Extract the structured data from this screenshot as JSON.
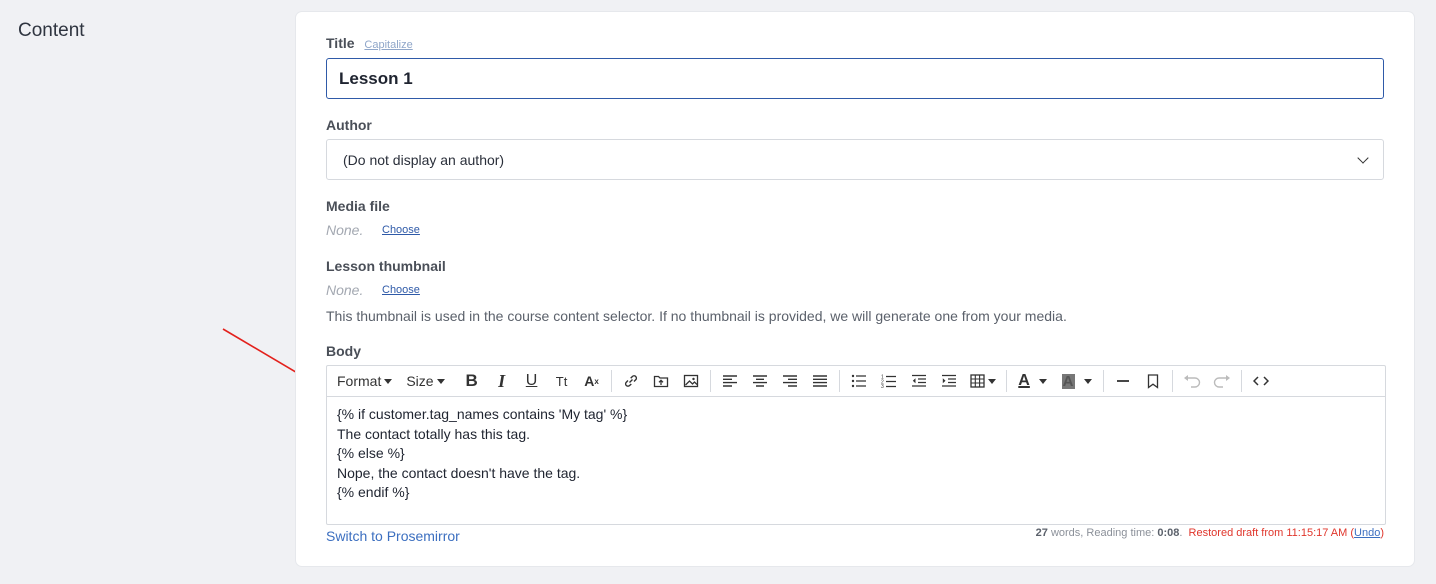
{
  "section": {
    "title": "Content"
  },
  "title_field": {
    "label": "Title",
    "capitalize_link": "Capitalize",
    "value": "Lesson 1"
  },
  "author_field": {
    "label": "Author",
    "selected": "(Do not display an author)"
  },
  "media_field": {
    "label": "Media file",
    "value": "None.",
    "choose_label": "Choose"
  },
  "thumbnail_field": {
    "label": "Lesson thumbnail",
    "value": "None.",
    "choose_label": "Choose",
    "help": "This thumbnail is used in the course content selector. If no thumbnail is provided, we will generate one from your media."
  },
  "body_field": {
    "label": "Body",
    "toolbar": {
      "format_label": "Format",
      "size_label": "Size",
      "tt_label": "Tt"
    },
    "lines": [
      "{% if customer.tag_names contains 'My tag' %}",
      "The contact totally has this tag.",
      "{% else %}",
      "Nope, the contact doesn't have the tag.",
      "{% endif %}"
    ],
    "switch_label": "Switch to Prosemirror"
  },
  "status": {
    "word_count": "27",
    "words_label": " words, Reading time: ",
    "reading_time": "0:08",
    "restored_prefix": "Restored draft from 11:15:17 AM (",
    "undo_label": "Undo",
    "restored_suffix": ")"
  },
  "colors": {
    "accent": "#2f5aa8",
    "link": "#3c6fc0",
    "warning": "#e0352b",
    "arrow": "#e3211c"
  }
}
